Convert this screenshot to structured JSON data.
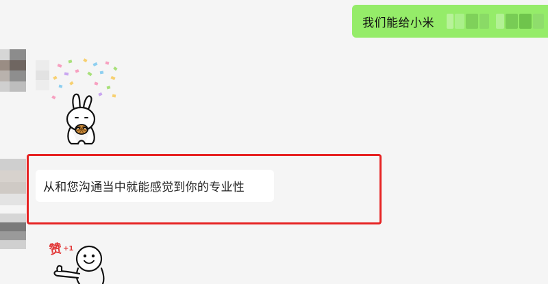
{
  "messages": [
    {
      "direction": "outgoing",
      "text": "我们能给小米",
      "redacted": true,
      "bubble_color": "#95ec69"
    },
    {
      "direction": "incoming",
      "sticker": "confetti-bunny-sticker"
    },
    {
      "direction": "incoming",
      "text": "从和您沟通当中就能感觉到你的专业性",
      "highlighted": true,
      "bubble_color": "#ffffff",
      "highlight_color": "#e62222"
    },
    {
      "direction": "incoming",
      "sticker": "thumbs-up-zan-sticker",
      "sticker_text": "赞",
      "sticker_badge": "+1"
    }
  ],
  "colors": {
    "background": "#f5f5f5",
    "outgoing_bubble": "#95ec69",
    "incoming_bubble": "#ffffff",
    "highlight": "#e62222"
  }
}
